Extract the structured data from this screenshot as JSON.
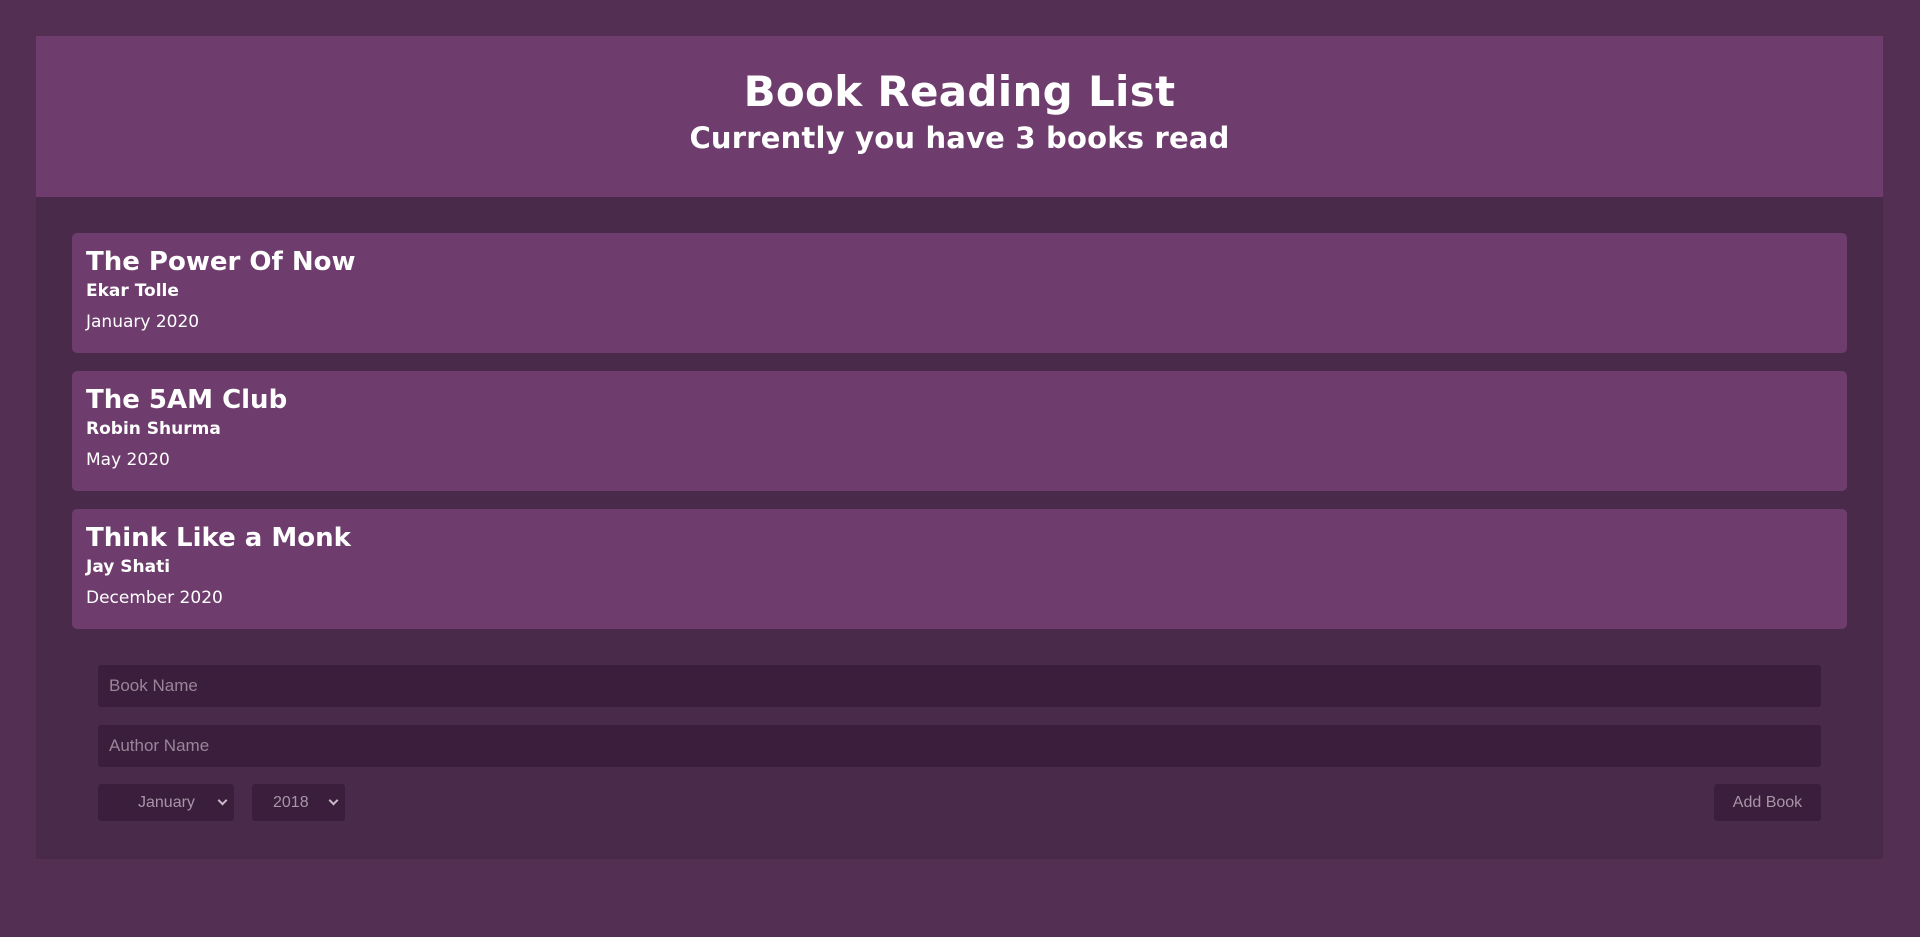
{
  "header": {
    "title": "Book Reading List",
    "subtitle": "Currently you have 3 books read"
  },
  "books": [
    {
      "title": "The Power Of Now",
      "author": "Ekar Tolle",
      "date": "January 2020"
    },
    {
      "title": "The 5AM Club",
      "author": "Robin Shurma",
      "date": "May 2020"
    },
    {
      "title": "Think Like a Monk",
      "author": "Jay Shati",
      "date": "December 2020"
    }
  ],
  "form": {
    "book_name_placeholder": "Book Name",
    "author_name_placeholder": "Author Name",
    "month_selected": "January",
    "year_selected": "2018",
    "add_button_label": "Add Book"
  },
  "colors": {
    "page_background": "#532f53",
    "panel_background": "#4a2a4b",
    "card_background": "#6e3d6d",
    "input_background": "#3b1e3c"
  }
}
